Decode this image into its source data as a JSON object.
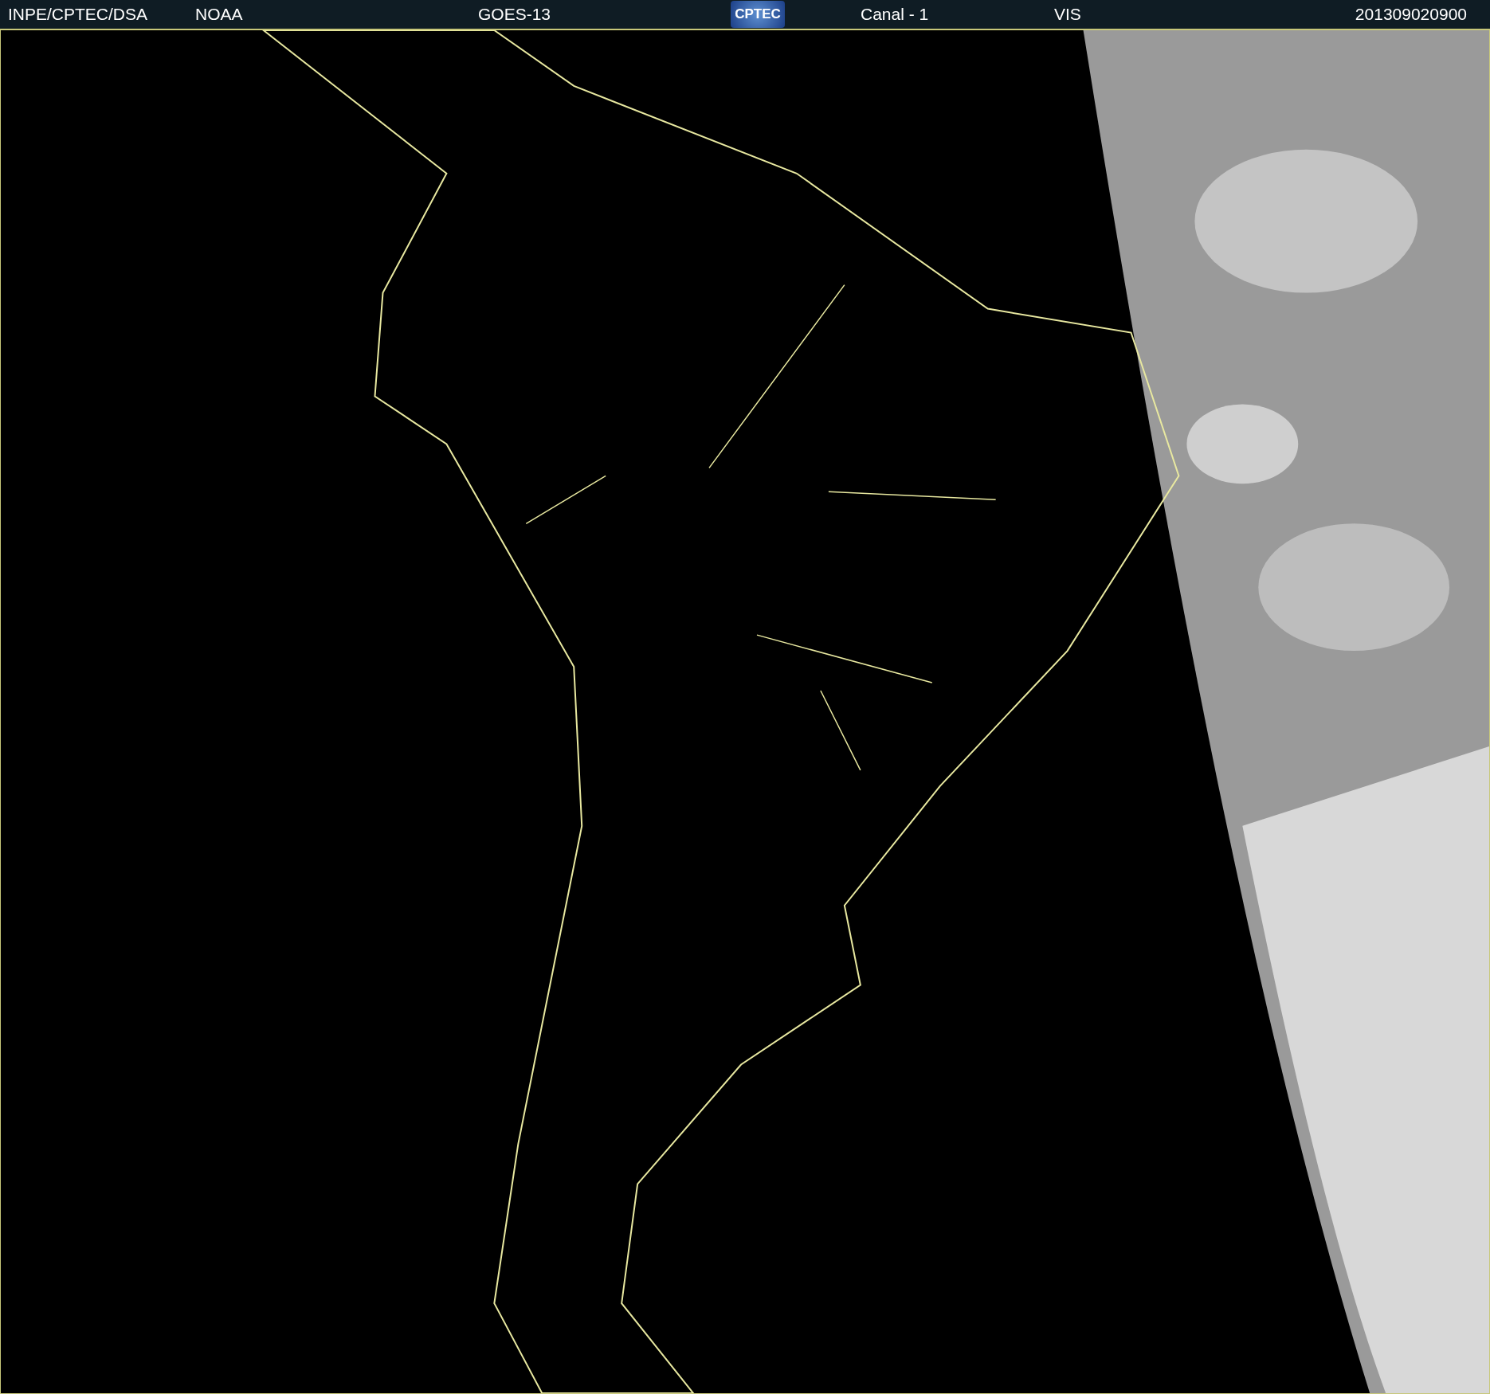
{
  "header": {
    "source": "INPE/CPTEC/DSA",
    "agency": "NOAA",
    "satellite": "GOES-13",
    "logo": "CPTEC",
    "channel": "Canal - 1",
    "band": "VIS",
    "timestamp": "201309020900"
  }
}
